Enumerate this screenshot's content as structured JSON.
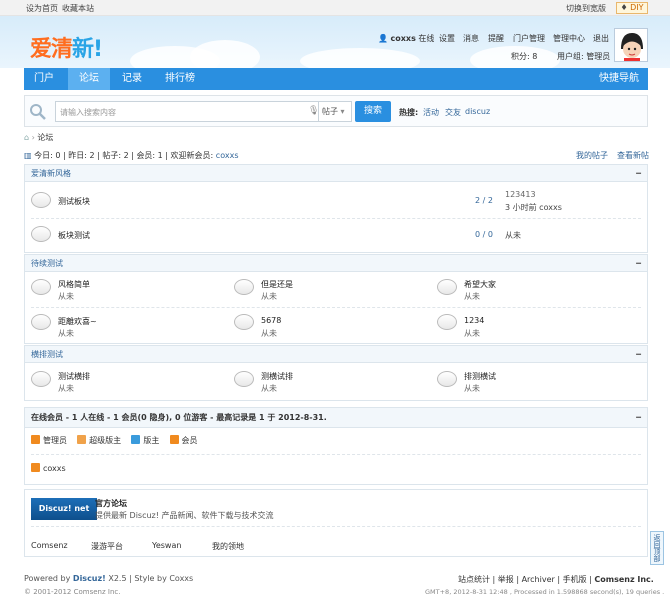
{
  "topbar": {
    "set_home": "设为首页",
    "favorite": "收藏本站",
    "switch_width": "切换到宽版",
    "diy": "DIY"
  },
  "logo": {
    "part1": "爱清",
    "part2": "新!"
  },
  "user": {
    "name": "coxxs",
    "status": "在线",
    "links": [
      "设置",
      "消息",
      "提醒",
      "门户管理",
      "管理中心",
      "退出"
    ],
    "points": "积分: 8",
    "group": "用户组: 管理员"
  },
  "nav": {
    "items": [
      "门户",
      "论坛",
      "记录",
      "排行榜"
    ],
    "active": 1,
    "quick": "快捷导航"
  },
  "search": {
    "placeholder": "请输入搜索内容",
    "type": "帖子",
    "button": "搜索",
    "hot_label": "热搜:",
    "hot": [
      "活动",
      "交友",
      "discuz"
    ]
  },
  "breadcrumb": {
    "current": "论坛"
  },
  "stats": {
    "today": "今日: 0",
    "yesterday": "昨日: 2",
    "posts": "帖子: 2",
    "members": "会员: 1",
    "welcome": "欢迎新会员:",
    "newest": "coxxs",
    "my_posts": "我的帖子",
    "new_posts": "查看新帖"
  },
  "categories": [
    {
      "title": "爱清新风格",
      "forums": [
        {
          "name": "测试板块",
          "counts": "2 / 2",
          "last_title": "123413",
          "last_meta": "3 小时前 coxxs"
        },
        {
          "name": "板块测试",
          "counts": "0 / 0",
          "last_title": "",
          "last_meta": "从未"
        }
      ]
    },
    {
      "title": "待续测试",
      "forums": [
        {
          "name": "风格简单",
          "sub": "从未"
        },
        {
          "name": "但是还是",
          "sub": "从未"
        },
        {
          "name": "希望大家",
          "sub": "从未"
        },
        {
          "name": "距離欢喜~",
          "sub": "从未"
        },
        {
          "name": "5678",
          "sub": "从未"
        },
        {
          "name": "1234",
          "sub": "从未"
        }
      ]
    },
    {
      "title": "横排测试",
      "forums": [
        {
          "name": "测试横排",
          "sub": "从未"
        },
        {
          "name": "测横试排",
          "sub": "从未"
        },
        {
          "name": "排测横试",
          "sub": "从未"
        }
      ]
    }
  ],
  "online": {
    "title": "在线会员 - 1 人在线 - 1 会员(0 隐身), 0 位游客 - 最高记录是 1 于 2012-8-31.",
    "legend": [
      "管理员",
      "超级版主",
      "版主",
      "会员"
    ],
    "users": [
      "coxxs"
    ]
  },
  "links": {
    "name": "官方论坛",
    "desc": "提供最新 Discuz! 产品新闻、软件下载与技术交流",
    "logo_text": "Discuz! net",
    "texts": [
      "Comsenz",
      "漫游平台",
      "Yeswan",
      "我的领地"
    ]
  },
  "backtop": "返回顶部",
  "footer": {
    "powered": "Powered by",
    "product": "Discuz!",
    "version": "X2.5",
    "style": "| Style by Coxxs",
    "copyright": "© 2001-2012 Comsenz Inc.",
    "links": [
      "站点统计",
      "举报",
      "Archiver",
      "手机版",
      "Comsenz Inc."
    ],
    "gmt": "GMT+8, 2012-8-31 12:48 , Processed in 1.598868 second(s), 19 queries ."
  },
  "colors": {
    "nav": "#2a8fe0",
    "logo_orange": "#ff6d1f",
    "logo_blue": "#29a4e6",
    "legend": [
      "#f08a1f",
      "#f08a1f",
      "#3a9bdc",
      "#f08a1f"
    ]
  }
}
